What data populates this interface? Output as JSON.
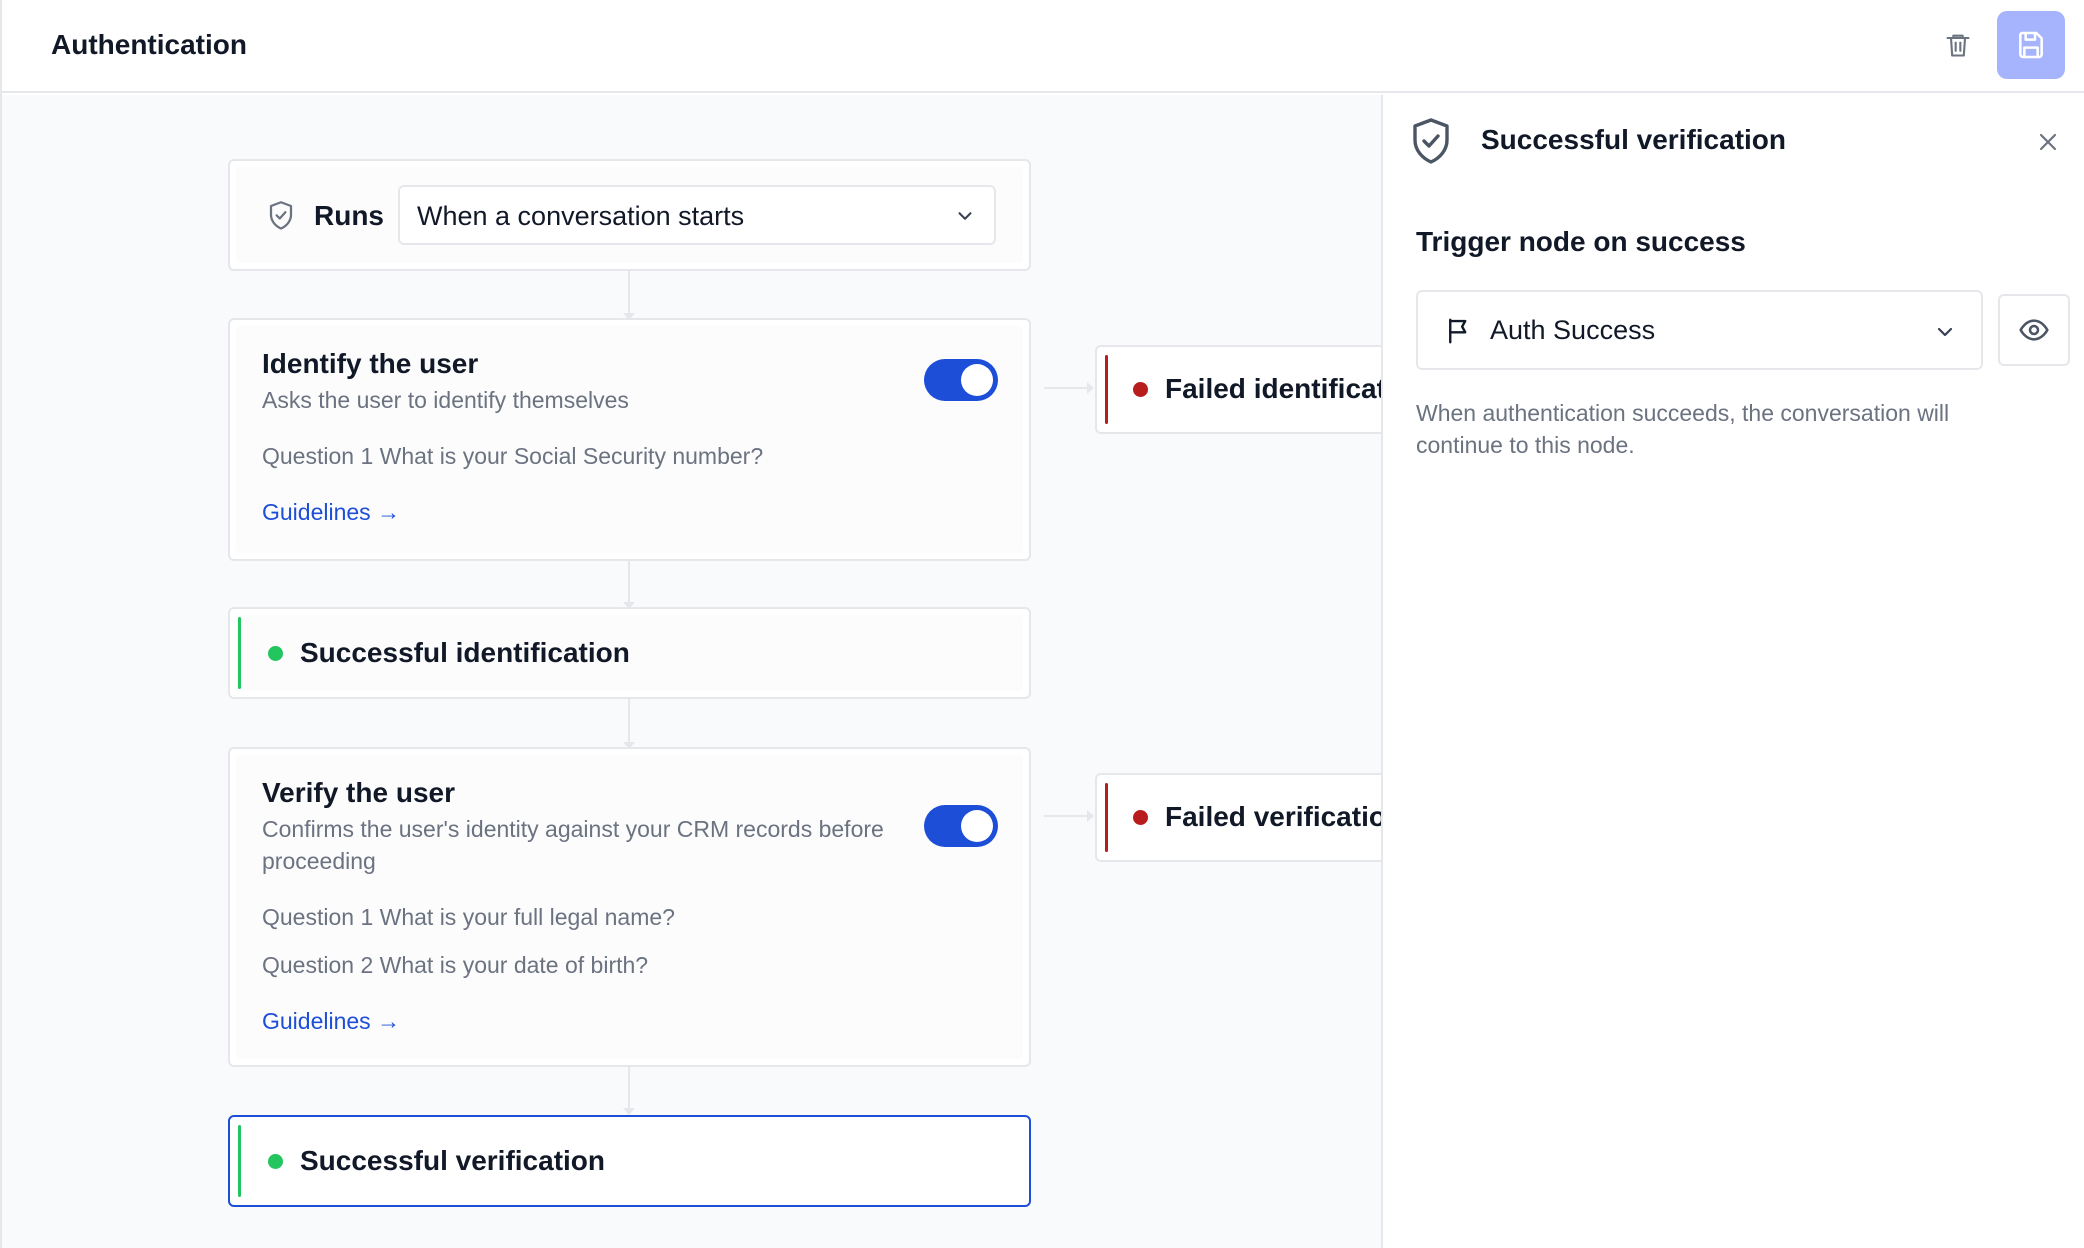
{
  "header": {
    "title": "Authentication",
    "delete_icon": "trash-icon",
    "save_icon": "save-icon"
  },
  "flow": {
    "runs": {
      "label": "Runs",
      "trigger_value": "When a conversation starts"
    },
    "identify": {
      "title": "Identify the user",
      "description": "Asks the user to identify themselves",
      "enabled": true,
      "questions": [
        "Question 1 What is your Social Security number?"
      ],
      "guidelines_label": "Guidelines →"
    },
    "failed_identification": {
      "label": "Failed identification"
    },
    "successful_identification": {
      "label": "Successful identification"
    },
    "verify": {
      "title": "Verify the user",
      "description": "Confirms the user's identity against your CRM records before proceeding",
      "enabled": true,
      "questions": [
        "Question 1 What is your full legal name?",
        "Question 2 What is your date of birth?"
      ],
      "guidelines_label": "Guidelines →"
    },
    "failed_verification": {
      "label": "Failed verification"
    },
    "successful_verification": {
      "label": "Successful verification",
      "selected": true
    }
  },
  "panel": {
    "title": "Successful verification",
    "section_label": "Trigger node on success",
    "node_select_value": "Auth Success",
    "helper_text": "When authentication succeeds, the conversation will continue to this node."
  },
  "colors": {
    "accent": "#1d4ed8",
    "save_button_bg": "#a5b4fc",
    "success": "#22c55e",
    "failure": "#b91c1c",
    "border": "#e5e7eb"
  }
}
